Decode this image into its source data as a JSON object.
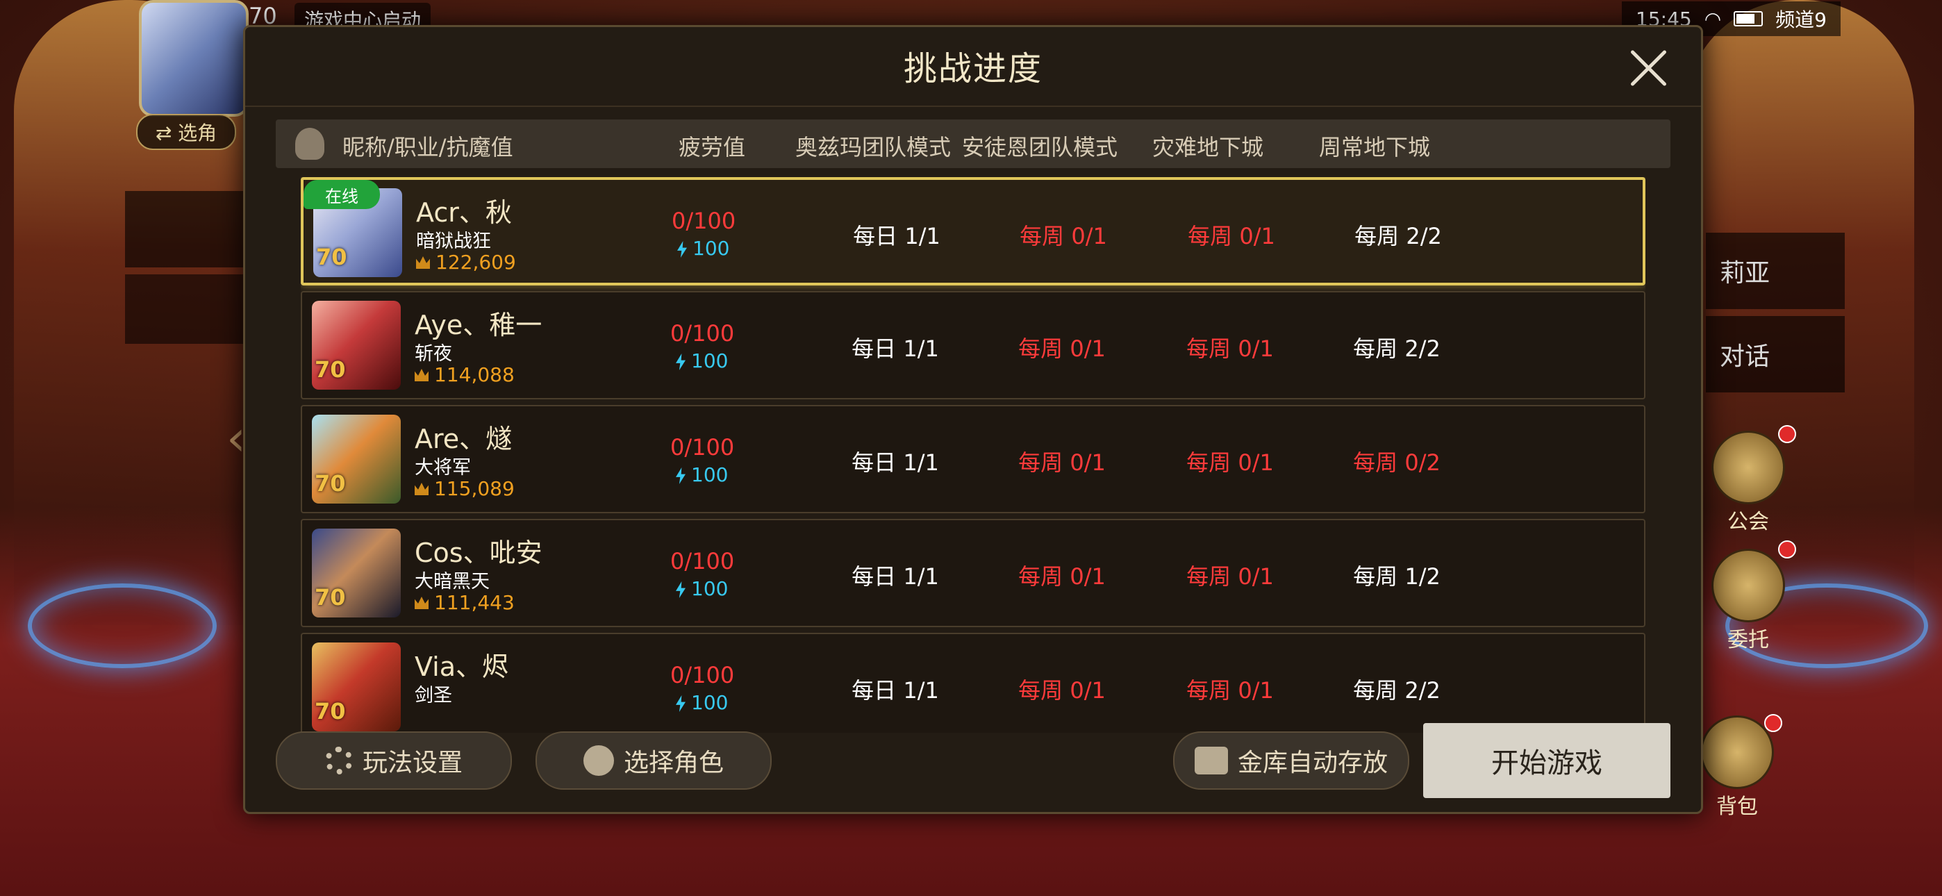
{
  "hud": {
    "level": "70",
    "gamecenter": "游戏中心启动",
    "switch_char": "⇄ 选角",
    "time": "15:45",
    "channel": "频道9",
    "side_right_1": "莉亚",
    "side_right_2": "对话",
    "guild_label": "公会",
    "commission_label": "委托",
    "bag_label": "背包"
  },
  "dialog": {
    "title": "挑战进度",
    "headers": {
      "name": "昵称/职业/抗魔值",
      "fatigue": "疲劳值",
      "ozma": "奥兹玛团队模式",
      "antoine": "安徒恩团队模式",
      "disaster": "灾难地下城",
      "weekly": "周常地下城"
    },
    "online_label": "在线",
    "characters": [
      {
        "name": "Acr、秋",
        "class": "暗狱战狂",
        "power": "122,609",
        "level": "70",
        "fatigue": "0/100",
        "energy": "100",
        "ozma": "每日 1/1",
        "antoine": "每周 0/1",
        "disaster": "每周 0/1",
        "weekly": "每周 2/2",
        "weekly_red": false
      },
      {
        "name": "Aye、稚一",
        "class": "斩夜",
        "power": "114,088",
        "level": "70",
        "fatigue": "0/100",
        "energy": "100",
        "ozma": "每日 1/1",
        "antoine": "每周 0/1",
        "disaster": "每周 0/1",
        "weekly": "每周 2/2",
        "weekly_red": false
      },
      {
        "name": "Are、燧",
        "class": "大将军",
        "power": "115,089",
        "level": "70",
        "fatigue": "0/100",
        "energy": "100",
        "ozma": "每日 1/1",
        "antoine": "每周 0/1",
        "disaster": "每周 0/1",
        "weekly": "每周 0/2",
        "weekly_red": true
      },
      {
        "name": "Cos、吡安",
        "class": "大暗黑天",
        "power": "111,443",
        "level": "70",
        "fatigue": "0/100",
        "energy": "100",
        "ozma": "每日 1/1",
        "antoine": "每周 0/1",
        "disaster": "每周 0/1",
        "weekly": "每周 1/2",
        "weekly_red": false
      },
      {
        "name": "Via、烬",
        "class": "剑圣",
        "power": "",
        "level": "70",
        "fatigue": "0/100",
        "energy": "100",
        "ozma": "每日 1/1",
        "antoine": "每周 0/1",
        "disaster": "每周 0/1",
        "weekly": "每周 2/2",
        "weekly_red": false
      }
    ],
    "buttons": {
      "play_settings": "玩法设置",
      "select_role": "选择角色",
      "vault_auto": "金库自动存放",
      "start_game": "开始游戏"
    }
  },
  "colors": {
    "red_text": "#ff3b3b",
    "energy": "#38c9f0",
    "power": "#f0a020",
    "selected_border": "#e0c65a",
    "online": "#22a33a"
  }
}
